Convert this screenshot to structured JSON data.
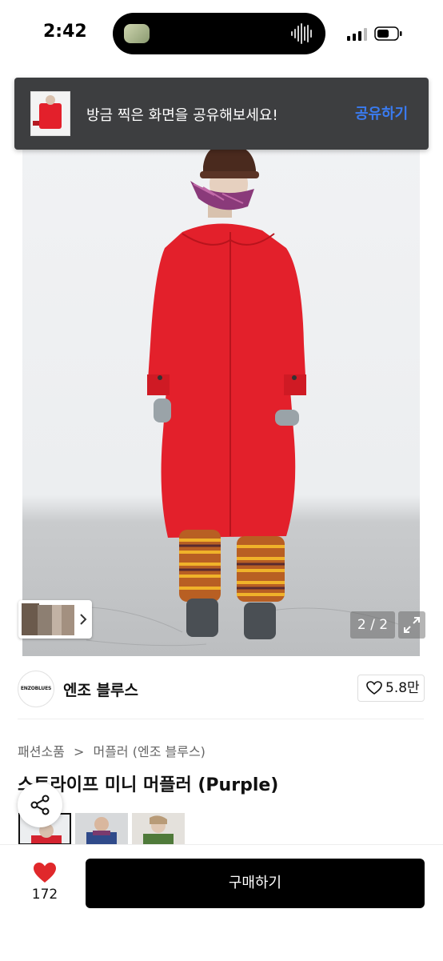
{
  "status_bar": {
    "time": "2:42",
    "signal_icon": "cellular-signal-icon",
    "battery_icon": "battery-icon"
  },
  "toast": {
    "message": "방금 찍은 화면을 공유해보세요!",
    "action_label": "공유하기",
    "action_color": "#3a7bf0"
  },
  "photo": {
    "counter": "2 / 2",
    "expand_icon": "expand-icon",
    "thumb_strip_chevron_icon": "chevron-right-icon"
  },
  "brand": {
    "logo_text": "ENZOBLUES",
    "name": "엔조 블루스",
    "likes": "5.8만",
    "like_icon": "heart-outline-icon"
  },
  "product": {
    "breadcrumb": [
      "패션소품",
      "머플러 (엔조 블루스)"
    ],
    "breadcrumb_separator": ">",
    "title": "스트라이프 미니 머플러 (Purple)"
  },
  "share_fab_icon": "share-icon",
  "bottom_bar": {
    "wish_count": "172",
    "wish_icon": "heart-filled-icon",
    "wish_color": "#e0282b",
    "buy_label": "구매하기"
  }
}
